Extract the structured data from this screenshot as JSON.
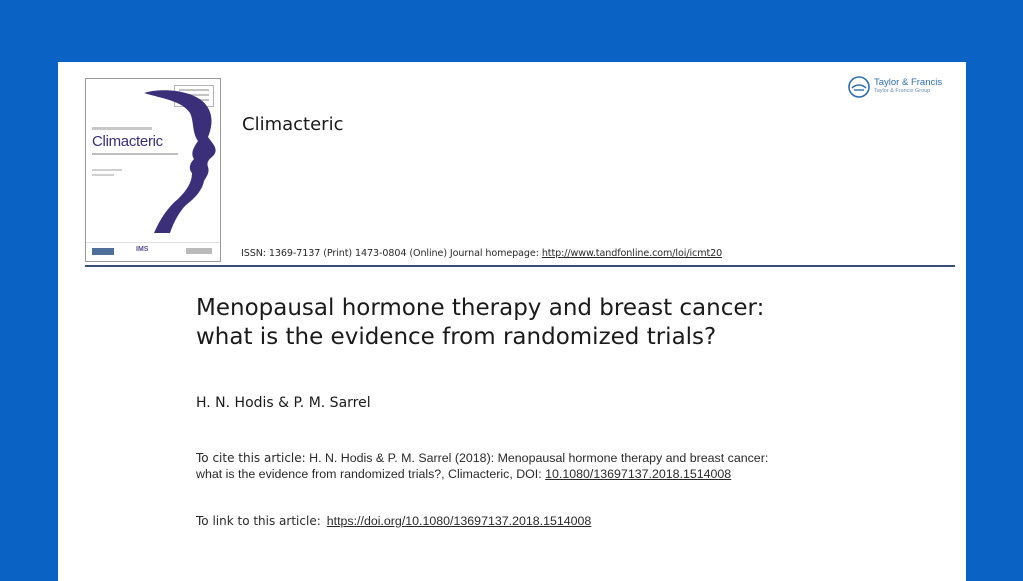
{
  "cover": {
    "title": "Climacteric",
    "footer_logo": "IMS"
  },
  "header": {
    "journal_name": "Climacteric",
    "issn_text": "ISSN: 1369-7137 (Print) 1473-0804 (Online) Journal homepage: ",
    "homepage_url": "http://www.tandfonline.com/loi/icmt20",
    "publisher_name": "Taylor & Francis",
    "publisher_group": "Taylor & Francis Group"
  },
  "article": {
    "title_line1": "Menopausal hormone therapy and breast cancer:",
    "title_line2": "what is the evidence from randomized trials?",
    "authors": "H. N. Hodis & P. M. Sarrel",
    "cite_label": "To cite this article:",
    "cite_text": " H. N. Hodis & P. M. Sarrel (2018): Menopausal hormone therapy and breast cancer: what is the evidence from randomized trials?, Climacteric, DOI: ",
    "cite_doi": "10.1080/13697137.2018.1514008",
    "link_label": "To link to this article:",
    "link_url": "https://doi.org/10.1080/13697137.2018.1514008"
  },
  "colors": {
    "background": "#0a63c4",
    "cover_purple": "#3c2f7a",
    "rule": "#3a4c7a",
    "publisher_blue": "#2e6db0"
  }
}
